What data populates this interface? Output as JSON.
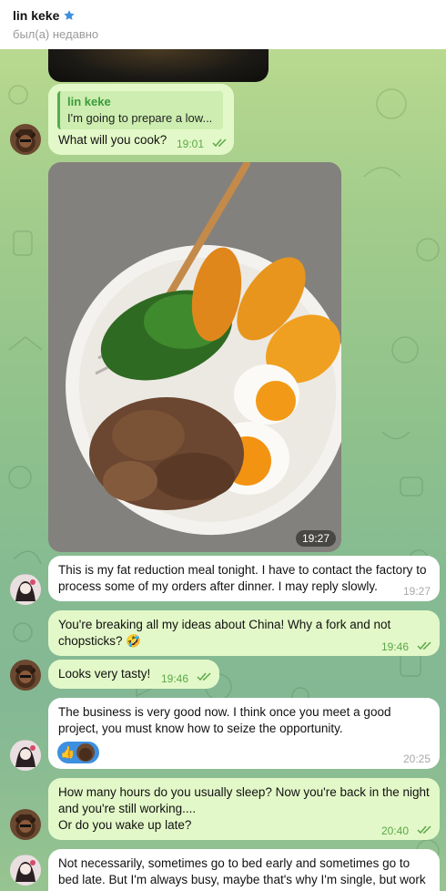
{
  "header": {
    "contact_name": "lin keke",
    "status": "был(а) недавно"
  },
  "messages": {
    "quote_reply": {
      "quote_name": "lin keke",
      "quote_text": "I'm going to prepare a low...",
      "text": "What will you cook?",
      "time": "19:01"
    },
    "photo": {
      "time": "19:27"
    },
    "m1": {
      "text1": "This is my fat reduction meal tonight. I have to contact the factory to",
      "text2": "process some of my orders after dinner. I may reply slowly.",
      "time": "19:27"
    },
    "m2": {
      "text1": "You're breaking all my ideas about China! Why a fork and not",
      "text2": "chopsticks? 🤣",
      "time": "19:46"
    },
    "m3": {
      "text": "Looks very tasty!",
      "time": "19:46"
    },
    "m4": {
      "text1": "The business is very good now. I think once you meet a good",
      "text2": "project, you must know how to seize the opportunity.",
      "reaction": "👍",
      "time": "20:25"
    },
    "m5": {
      "text1": "How many hours do you usually sleep? Now you're back in the night",
      "text2": "and you're still working....",
      "text3": "Or do you wake up late?",
      "time": "20:40"
    },
    "m6": {
      "text1": "Not necessarily, sometimes go to bed early and sometimes go to",
      "text2": "bed late. But I'm always busy, maybe that's why I'm single, but work"
    }
  },
  "colors": {
    "outgoing_bubble": "#e3f8c8",
    "incoming_bubble": "#ffffff",
    "accent_green": "#4fae4e",
    "star_blue": "#3d8fe0"
  },
  "icons": [
    "verified-star-icon",
    "double-check-icon",
    "thumbs-up-emoji"
  ]
}
